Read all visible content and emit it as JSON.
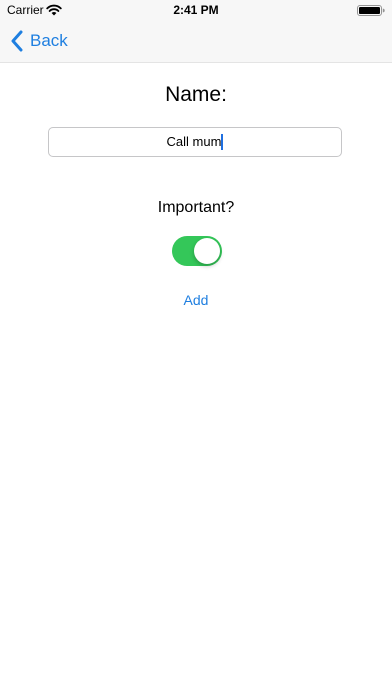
{
  "status_bar": {
    "carrier": "Carrier",
    "time": "2:41 PM",
    "icons": [
      "wifi-icon",
      "battery-icon"
    ]
  },
  "nav": {
    "back_label": "Back",
    "back_icon": "chevron-left-icon"
  },
  "form": {
    "name_title": "Name:",
    "name_value": "Call mum",
    "important_label": "Important?",
    "important_on": true,
    "add_label": "Add"
  },
  "colors": {
    "accent": "#1f7fe0",
    "toggle_on": "#34c759",
    "bar_background": "#f7f7f7"
  }
}
